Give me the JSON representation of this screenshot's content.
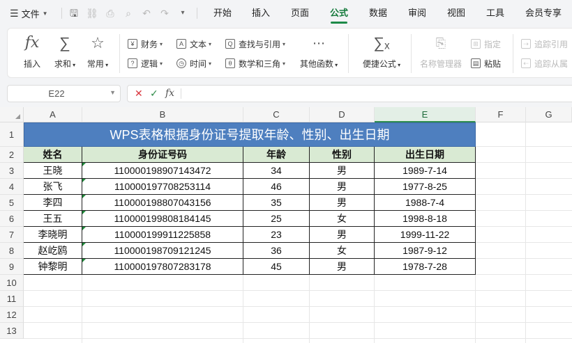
{
  "menu": {
    "file_label": "文件",
    "tabs": [
      {
        "label": "开始",
        "active": false
      },
      {
        "label": "插入",
        "active": false
      },
      {
        "label": "页面",
        "active": false
      },
      {
        "label": "公式",
        "active": true
      },
      {
        "label": "数据",
        "active": false
      },
      {
        "label": "审阅",
        "active": false
      },
      {
        "label": "视图",
        "active": false
      },
      {
        "label": "工具",
        "active": false
      },
      {
        "label": "会员专享",
        "active": false
      }
    ],
    "quick_icons": [
      "menu-icon",
      "save-icon",
      "share-icon",
      "print-icon",
      "print-preview-icon",
      "undo-icon",
      "redo-icon",
      "more-icon"
    ]
  },
  "ribbon": {
    "insert_label": "插入",
    "sum_label": "求和",
    "common_label": "常用",
    "finance_label": "财务",
    "text_label": "文本",
    "lookup_label": "查找与引用",
    "logic_label": "逻辑",
    "time_label": "时间",
    "math_label": "数学和三角",
    "other_label": "其他函数",
    "quick_formula_label": "便捷公式",
    "name_manager_label": "名称管理器",
    "specify_label": "指定",
    "paste_label": "粘贴",
    "trace_ref_label": "追踪引用",
    "trace_dep_label": "追踪从属"
  },
  "formula_bar": {
    "name_box": "E22",
    "cancel_symbol": "✕",
    "confirm_symbol": "✓",
    "fx_symbol": "fx",
    "value": ""
  },
  "sheet": {
    "columns": [
      "A",
      "B",
      "C",
      "D",
      "E",
      "F",
      "G"
    ],
    "selected_column": "E",
    "rows": [
      "1",
      "2",
      "3",
      "4",
      "5",
      "6",
      "7",
      "8",
      "9",
      "10",
      "11",
      "12",
      "13"
    ],
    "title": "WPS表格根据身份证号提取年龄、性别、出生日期",
    "headers": [
      "姓名",
      "身份证号码",
      "年龄",
      "性别",
      "出生日期"
    ],
    "records": [
      [
        "王晓",
        "110000198907143472",
        "34",
        "男",
        "1989-7-14"
      ],
      [
        "张飞",
        "110000197708253114",
        "46",
        "男",
        "1977-8-25"
      ],
      [
        "李四",
        "110000198807043156",
        "35",
        "男",
        "1988-7-4"
      ],
      [
        "王五",
        "110000199808184145",
        "25",
        "女",
        "1998-8-18"
      ],
      [
        "李晓明",
        "110000199911225858",
        "23",
        "男",
        "1999-11-22"
      ],
      [
        "赵屹鸥",
        "110000198709121245",
        "36",
        "女",
        "1987-9-12"
      ],
      [
        "钟黎明",
        "110000197807283178",
        "45",
        "男",
        "1978-7-28"
      ]
    ],
    "colors": {
      "title_fill": "#4e7fbf",
      "header_fill": "#d9ead3",
      "active_tab": "#157a3c"
    }
  }
}
